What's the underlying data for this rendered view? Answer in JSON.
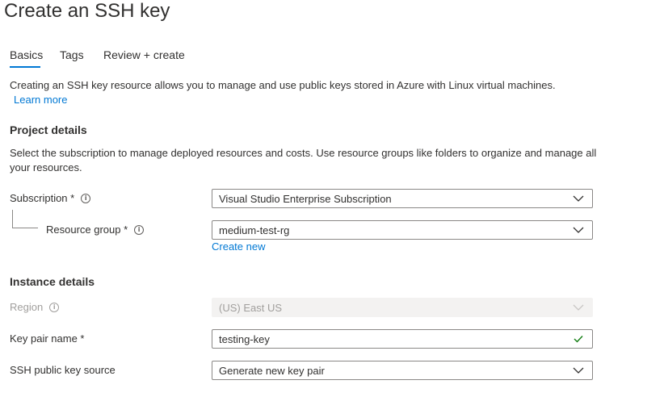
{
  "page": {
    "title": "Create an SSH key"
  },
  "tabs": [
    {
      "label": "Basics",
      "active": true
    },
    {
      "label": "Tags",
      "active": false
    },
    {
      "label": "Review + create",
      "active": false
    }
  ],
  "intro": {
    "text": "Creating an SSH key resource allows you to manage and use public keys stored in Azure with Linux virtual machines.",
    "learn_more": "Learn more"
  },
  "project_details": {
    "heading": "Project details",
    "description_line1": "Select the subscription to manage deployed resources and costs. Use resource groups like folders to organize and manage all",
    "description_line2": "your resources.",
    "subscription": {
      "label": "Subscription *",
      "value": "Visual Studio Enterprise Subscription"
    },
    "resource_group": {
      "label": "Resource group *",
      "value": "medium-test-rg",
      "create_new": "Create new"
    }
  },
  "instance_details": {
    "heading": "Instance details",
    "region": {
      "label": "Region",
      "value": "(US) East US",
      "disabled": true
    },
    "key_pair_name": {
      "label": "Key pair name *",
      "value": "testing-key"
    },
    "ssh_public_key_source": {
      "label": "SSH public key source",
      "value": "Generate new key pair"
    }
  },
  "icons": {
    "info": "info-icon",
    "dropdown": "chevron-down-icon",
    "valid": "checkmark-icon"
  },
  "colors": {
    "accent": "#0078d4",
    "text": "#323130",
    "valid": "#107c10"
  }
}
